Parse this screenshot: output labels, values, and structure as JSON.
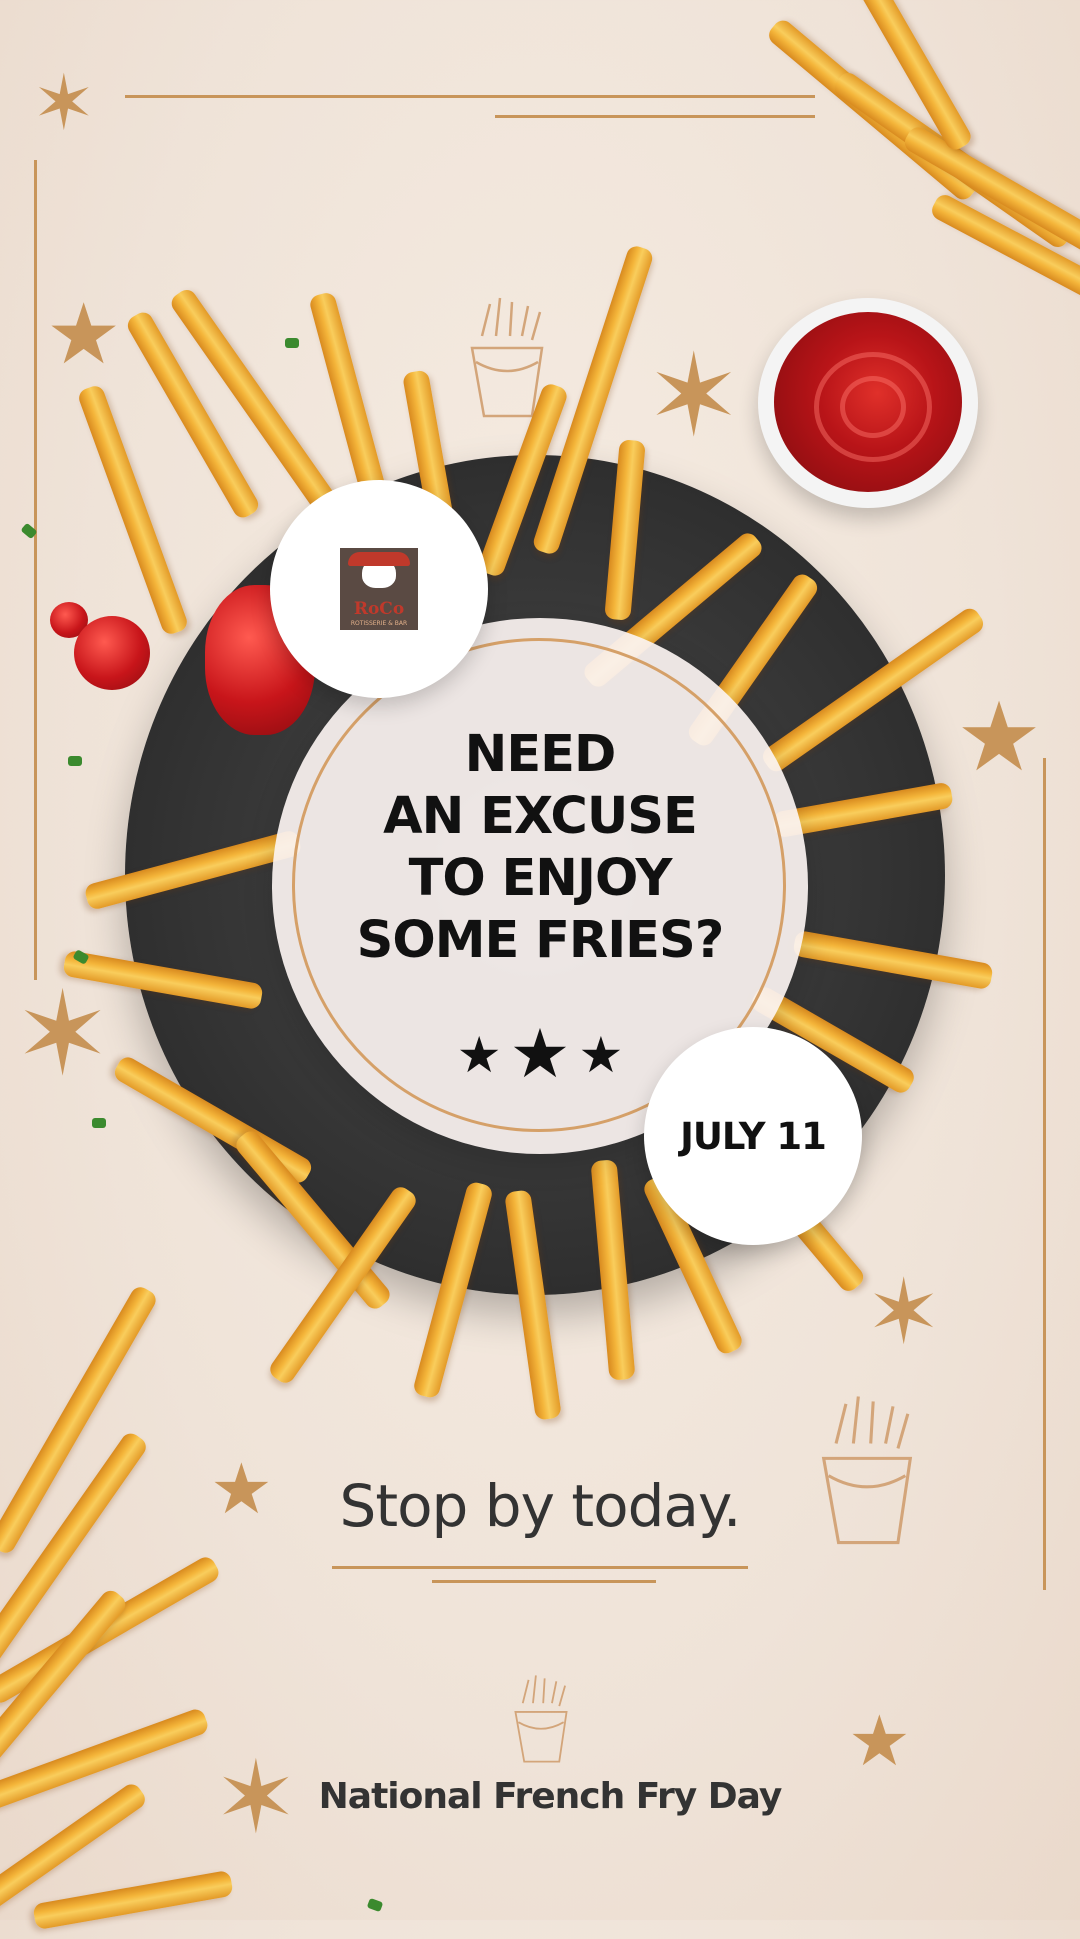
{
  "logo": {
    "name": "RoCo",
    "subtitle": "ROTISSERIE & BAR"
  },
  "headline": "NEED\nAN EXCUSE\nTO ENJOY\nSOME FRIES?",
  "rating": {
    "stars": 3
  },
  "date": "JULY 11",
  "tagline": "Stop by today.",
  "footer": "National French Fry Day",
  "colors": {
    "accent": "#c8955a",
    "text": "#111111",
    "background": "#efe3d8"
  },
  "icons": [
    "sparkle-star-icon",
    "fries-box-icon",
    "star-icon"
  ]
}
